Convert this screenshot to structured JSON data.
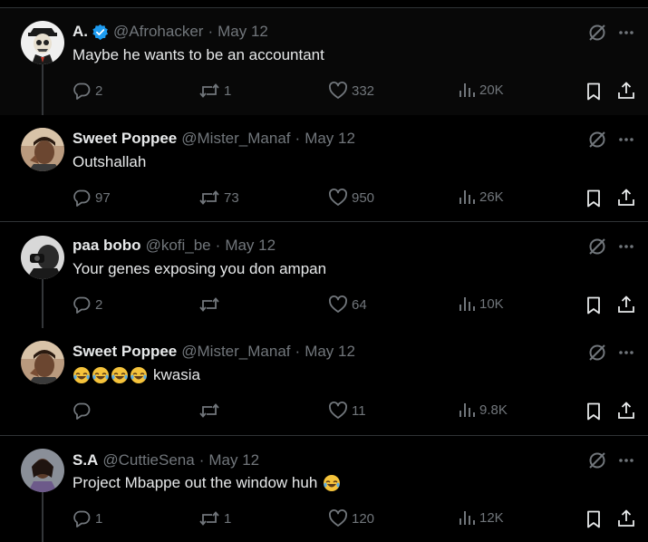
{
  "tweets": [
    {
      "name": "A.",
      "verified": true,
      "handle": "@Afrohacker",
      "date": "May 12",
      "text": "Maybe he wants to be an accountant",
      "emojis": 0,
      "replies": "2",
      "reposts": "1",
      "likes": "332",
      "views": "20K",
      "avatar": "skull-avatar"
    },
    {
      "name": "Sweet Poppee",
      "verified": false,
      "handle": "@Mister_Manaf",
      "date": "May 12",
      "text": "Outshallah",
      "emojis": 0,
      "replies": "97",
      "reposts": "73",
      "likes": "950",
      "views": "26K",
      "avatar": "photo-avatar"
    },
    {
      "name": "paa bobo",
      "verified": false,
      "handle": "@kofi_be",
      "date": "May 12",
      "text": "Your genes exposing you don ampan",
      "emojis": 0,
      "replies": "2",
      "reposts": "",
      "likes": "64",
      "views": "10K",
      "avatar": "bw-photo-avatar"
    },
    {
      "name": "Sweet Poppee",
      "verified": false,
      "handle": "@Mister_Manaf",
      "date": "May 12",
      "text": "kwasia",
      "emojis": 4,
      "replies": "",
      "reposts": "",
      "likes": "11",
      "views": "9.8K",
      "avatar": "photo-avatar"
    },
    {
      "name": "S.A",
      "verified": false,
      "handle": "@CuttieSena",
      "date": "May 12",
      "text": "Project Mbappe out the window huh",
      "emojis": 1,
      "replies": "1",
      "reposts": "1",
      "likes": "120",
      "views": "12K",
      "avatar": "portrait-avatar"
    }
  ],
  "icons": {
    "reply": "reply-icon",
    "repost": "repost-icon",
    "like": "like-icon",
    "views": "views-icon",
    "bookmark": "bookmark-icon",
    "share": "share-icon",
    "grok": "grok-icon",
    "more": "more-icon",
    "emoji": "rolling-laughing-emoji"
  },
  "colors": {
    "background": "#000000",
    "highlight": "#080808",
    "text": "#e7e9ea",
    "muted": "#71767b",
    "divider": "#2f3336",
    "verified": "#1d9bf0"
  }
}
